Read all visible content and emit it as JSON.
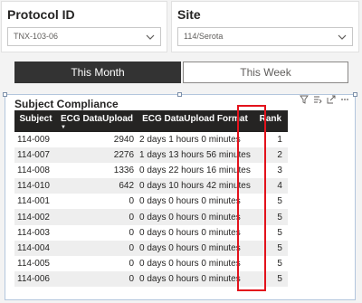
{
  "protocol_slicer": {
    "label": "Protocol ID",
    "value": "TNX-103-06"
  },
  "site_slicer": {
    "label": "Site",
    "value": "114/Serota"
  },
  "toggle": {
    "this_month": "This Month",
    "this_week": "This Week"
  },
  "visual": {
    "title": "Subject Compliance",
    "columns": [
      "Subject",
      "ECG DataUpload",
      "ECG DataUpload Format",
      "Rank"
    ],
    "rows": [
      [
        "114-009",
        "2940",
        "2 days 1 hours 0 minutes",
        "1"
      ],
      [
        "114-007",
        "2276",
        "1 days 13 hours 56 minutes",
        "2"
      ],
      [
        "114-008",
        "1336",
        "0 days 22 hours 16 minutes",
        "3"
      ],
      [
        "114-010",
        "642",
        "0 days 10 hours 42 minutes",
        "4"
      ],
      [
        "114-001",
        "0",
        "0 days 0 hours 0 minutes",
        "5"
      ],
      [
        "114-002",
        "0",
        "0 days 0 hours 0 minutes",
        "5"
      ],
      [
        "114-003",
        "0",
        "0 days 0 hours 0 minutes",
        "5"
      ],
      [
        "114-004",
        "0",
        "0 days 0 hours 0 minutes",
        "5"
      ],
      [
        "114-005",
        "0",
        "0 days 0 hours 0 minutes",
        "5"
      ],
      [
        "114-006",
        "0",
        "0 days 0 hours 0 minutes",
        "5"
      ]
    ]
  }
}
